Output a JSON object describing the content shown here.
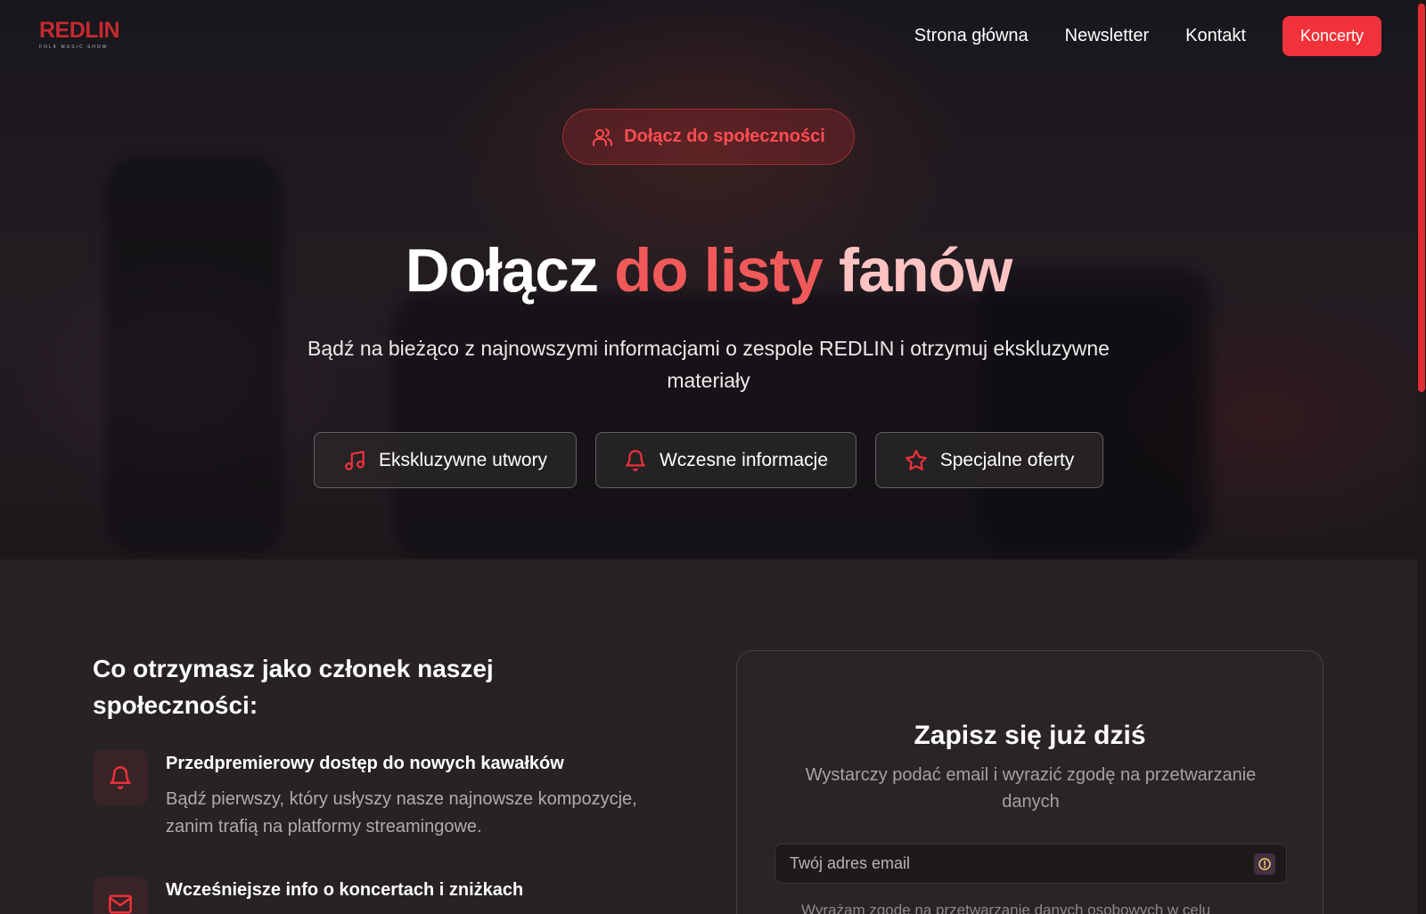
{
  "brand": {
    "logo_text": "REDLIN",
    "logo_tagline": "FOLK MUSIC SHOW",
    "accent_color": "#f2323a"
  },
  "nav": {
    "links": [
      "Strona główna",
      "Newsletter",
      "Kontakt"
    ],
    "cta_label": "Koncerty"
  },
  "hero": {
    "badge_icon": "users-icon",
    "badge_label": "Dołącz do społeczności",
    "title_part1": "Dołącz",
    "title_part2": "do listy",
    "title_part3": "fanów",
    "subtitle": "Bądź na bieżąco z najnowszymi informacjami o zespole REDLIN i otrzymuj ekskluzywne materiały",
    "features": [
      {
        "icon": "music-note-icon",
        "label": "Ekskluzywne utwory"
      },
      {
        "icon": "bell-icon",
        "label": "Wczesne informacje"
      },
      {
        "icon": "star-icon",
        "label": "Specjalne oferty"
      }
    ]
  },
  "benefits": {
    "heading": "Co otrzymasz jako członek naszej społeczności:",
    "items": [
      {
        "icon": "bell-icon",
        "title": "Przedpremierowy dostęp do nowych kawałków",
        "description": "Bądź pierwszy, który usłyszy nasze najnowsze kompozycje, zanim trafią na platformy streamingowe."
      },
      {
        "icon": "mail-icon",
        "title": "Wcześniejsze info o koncertach i zniżkach",
        "description": ""
      }
    ]
  },
  "signup": {
    "title": "Zapisz się już dziś",
    "subtitle": "Wystarczy podać email i wyrazić zgodę na przetwarzanie danych",
    "email_placeholder": "Twój adres email",
    "consent_text": "Wyrażam zgodę na przetwarzanie danych osobowych w celu"
  }
}
